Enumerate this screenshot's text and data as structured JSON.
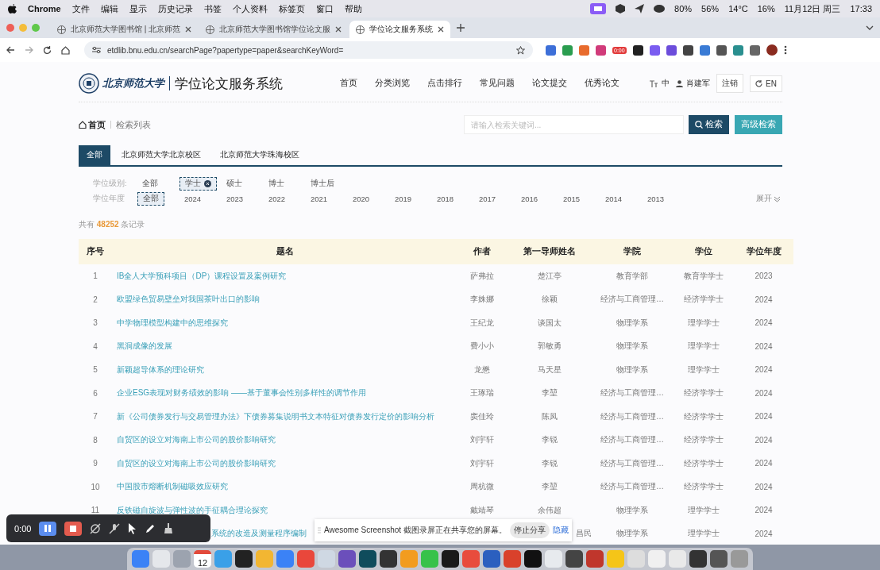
{
  "menu_bar": {
    "app": "Chrome",
    "menus": [
      "文件",
      "编辑",
      "显示",
      "历史记录",
      "书签",
      "个人资料",
      "标签页",
      "窗口",
      "帮助"
    ],
    "status": [
      "80%",
      "56%",
      "14°C",
      "16%"
    ],
    "date": "11月12日 周三",
    "time": "17:33"
  },
  "browser": {
    "tabs": [
      {
        "title": "北京师范大学图书馆 | 北京师范",
        "selected": false
      },
      {
        "title": "北京师范大学图书馆学位论文服",
        "selected": false
      },
      {
        "title": "学位论文服务系统",
        "selected": true
      }
    ],
    "url": "etdlib.bnu.edu.cn/searchPage?papertype=paper&searchKeyWord=",
    "extension_badge": "0:00"
  },
  "site": {
    "logo_text": "北京师范大学",
    "title": "学位论文服务系统",
    "nav": [
      "首页",
      "分类浏览",
      "点击排行",
      "常见问题",
      "论文提交",
      "优秀论文"
    ],
    "font_size": "中",
    "user": "肖建军",
    "logout": "注销",
    "language": "EN"
  },
  "breadcrumb": [
    "首页",
    "检索列表"
  ],
  "search": {
    "placeholder": "请输入检索关键词...",
    "button": "检索",
    "advanced": "高级检索"
  },
  "campus_tabs": [
    {
      "label": "全部",
      "selected": true
    },
    {
      "label": "北京师范大学北京校区",
      "selected": false
    },
    {
      "label": "北京师范大学珠海校区",
      "selected": false
    }
  ],
  "filters": [
    {
      "label": "学位级别:",
      "clearable": true,
      "options": [
        {
          "label": "全部",
          "selected": false
        },
        {
          "label": "学士",
          "selected": true
        },
        {
          "label": "硕士",
          "selected": false
        },
        {
          "label": "博士",
          "selected": false
        },
        {
          "label": "博士后",
          "selected": false
        }
      ]
    },
    {
      "label": "学位年度",
      "clearable": false,
      "options": [
        {
          "label": "全部",
          "selected": true
        },
        {
          "label": "2024",
          "selected": false
        },
        {
          "label": "2023",
          "selected": false
        },
        {
          "label": "2022",
          "selected": false
        },
        {
          "label": "2021",
          "selected": false
        },
        {
          "label": "2020",
          "selected": false
        },
        {
          "label": "2019",
          "selected": false
        },
        {
          "label": "2018",
          "selected": false
        },
        {
          "label": "2017",
          "selected": false
        },
        {
          "label": "2016",
          "selected": false
        },
        {
          "label": "2015",
          "selected": false
        },
        {
          "label": "2014",
          "selected": false
        },
        {
          "label": "2013",
          "selected": false
        }
      ]
    }
  ],
  "expand": "展开",
  "total": {
    "prefix": "共有",
    "count": "48252",
    "suffix": "条记录"
  },
  "table": {
    "columns": [
      "序号",
      "题名",
      "作者",
      "第一导师姓名",
      "学院",
      "学位",
      "学位年度"
    ],
    "rows": [
      {
        "no": "1",
        "title": "IB全人大学预科项目（DP）课程设置及案例研究",
        "author": "萨弗拉",
        "advisor": "楚江亭",
        "college": "教育学部",
        "degree": "教育学学士",
        "year": "2023"
      },
      {
        "no": "2",
        "title": "欧盟绿色贸易壁垒对我国茶叶出口的影响",
        "author": "李姝娜",
        "advisor": "徐颖",
        "college": "经济与工商管理…",
        "degree": "经济学学士",
        "year": "2024"
      },
      {
        "no": "3",
        "title": "中学物理模型构建中的思维探究",
        "author": "王纪龙",
        "advisor": "谈国太",
        "college": "物理学系",
        "degree": "理学学士",
        "year": "2024"
      },
      {
        "no": "4",
        "title": "黑洞成像的发展",
        "author": "费小小",
        "advisor": "郭敏勇",
        "college": "物理学系",
        "degree": "理学学士",
        "year": "2024"
      },
      {
        "no": "5",
        "title": "新颖超导体系的理论研究",
        "author": "龙懋",
        "advisor": "马天星",
        "college": "物理学系",
        "degree": "理学学士",
        "year": "2024"
      },
      {
        "no": "6",
        "title": "企业ESG表现对财务绩效的影响 ——基于董事会性别多样性的调节作用",
        "author": "王琢瑞",
        "advisor": "李堃",
        "college": "经济与工商管理…",
        "degree": "经济学学士",
        "year": "2024"
      },
      {
        "no": "7",
        "title": "新《公司债券发行与交易管理办法》下债券募集说明书文本特征对债券发行定价的影响分析",
        "author": "窦佳玲",
        "advisor": "陈凤",
        "college": "经济与工商管理…",
        "degree": "经济学学士",
        "year": "2024"
      },
      {
        "no": "8",
        "title": "自贸区的设立对海南上市公司的股价影响研究",
        "author": "刘宇轩",
        "advisor": "李锐",
        "college": "经济与工商管理…",
        "degree": "经济学学士",
        "year": "2024"
      },
      {
        "no": "9",
        "title": "自贸区的设立对海南上市公司的股价影响研究",
        "author": "刘宇轩",
        "advisor": "李锐",
        "college": "经济与工商管理…",
        "degree": "经济学学士",
        "year": "2024"
      },
      {
        "no": "10",
        "title": "中国股市熔断机制磁吸效应研究",
        "author": "周杭微",
        "advisor": "李堃",
        "college": "经济与工商管理…",
        "degree": "经济学学士",
        "year": "2024"
      },
      {
        "no": "11",
        "title": "反铁磁自旋波与弹性波的手征耦合理论探究",
        "author": "戴靖琴",
        "advisor": "余伟超",
        "college": "物理学系",
        "degree": "理学学士",
        "year": "2024"
      },
      {
        "title": "系统的改造及测量程序编制",
        "advisor": "昌民",
        "college": "物理学系",
        "degree": "理学学士",
        "year": "2024"
      }
    ]
  },
  "recorder": {
    "time": "0:00"
  },
  "share_bar": {
    "message": "Awesome Screenshot 截图录屏正在共享您的屏幕。",
    "stop": "停止分享",
    "hide": "隐藏"
  },
  "dock": {
    "calendar_day": "12"
  }
}
